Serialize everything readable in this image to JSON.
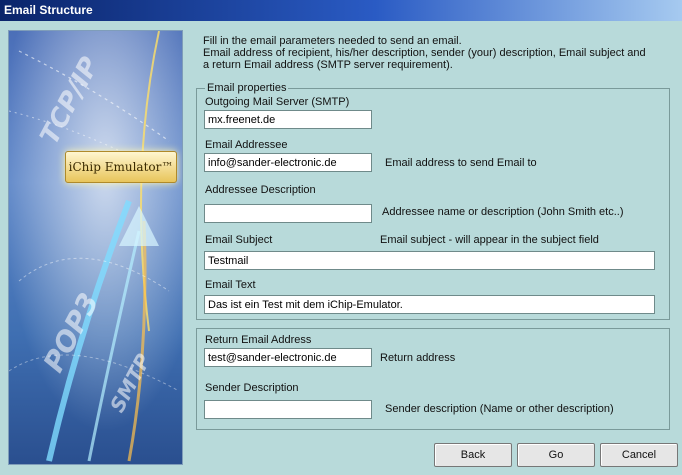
{
  "window": {
    "title": "Email Structure"
  },
  "splash": {
    "logo_text": "iChip Emulator™",
    "words": [
      "TCP/IP",
      "POP3",
      "SMTP"
    ]
  },
  "intro": {
    "line1": "Fill in the email parameters needed to send an email.",
    "line2": "Email address of recipient, his/her description, sender (your) description, Email subject and",
    "line3": "a return Email address (SMTP server requirement)."
  },
  "email_properties": {
    "legend": "Email properties",
    "outgoing_server_label": "Outgoing Mail Server (SMTP)",
    "outgoing_server_value": "mx.freenet.de",
    "addressee_label": "Email Addressee",
    "addressee_value": "info@sander-electronic.de",
    "addressee_hint": "Email address to send Email to",
    "addressee_desc_label": "Addressee Description",
    "addressee_desc_value": "",
    "addressee_desc_hint": "Addressee name or description (John Smith etc..)",
    "subject_label": "Email Subject",
    "subject_hint": "Email subject - will appear in the subject field",
    "subject_value": "Testmail",
    "text_label": "Email Text",
    "text_value": "Das ist ein Test mit dem iChip-Emulator."
  },
  "return_section": {
    "return_label": "Return Email Address",
    "return_value": "test@sander-electronic.de",
    "return_hint": "Return address",
    "sender_desc_label": "Sender Description",
    "sender_desc_value": "",
    "sender_desc_hint": "Sender description (Name or other description)"
  },
  "buttons": {
    "back": "Back",
    "go": "Go",
    "cancel": "Cancel"
  }
}
